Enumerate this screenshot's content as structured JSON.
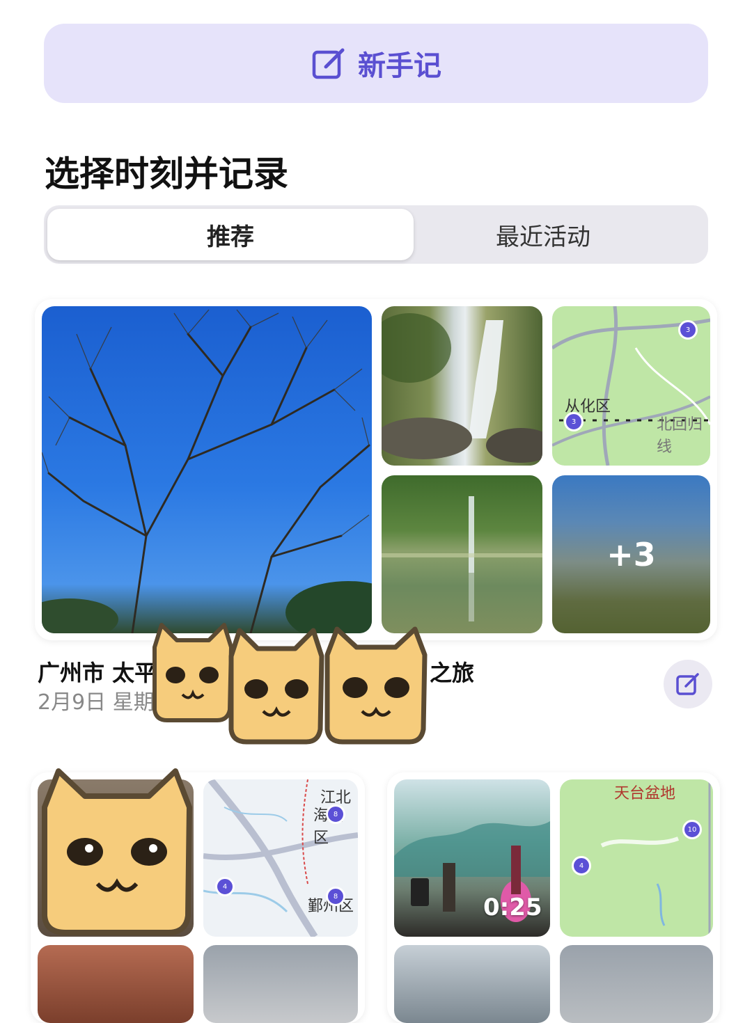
{
  "new_note": {
    "label": "新手记",
    "icon": "compose-icon",
    "accent": "#5a4fd1"
  },
  "section_title": "选择时刻并记录",
  "tabs": [
    {
      "label": "推荐",
      "selected": true
    },
    {
      "label": "最近活动",
      "selected": false
    }
  ],
  "moment1": {
    "title_left": "广州市 太平",
    "title_right": "之旅",
    "date": "2月9日 星期",
    "more_count": "+3",
    "map_labels": [
      "从化区",
      "北回归线"
    ],
    "map_badges": [
      "3",
      "3"
    ]
  },
  "moment2": {
    "map_labels": [
      "江北",
      "海曙区",
      "鄞州区"
    ],
    "map_badges": [
      "8",
      "4",
      "8"
    ]
  },
  "moment3": {
    "video_duration": "0:25",
    "map_labels": [
      "天台盆地"
    ],
    "map_badges": [
      "10",
      "4"
    ]
  },
  "stickers": {
    "icon": "cat-face-sticker-icon",
    "count": 4
  }
}
